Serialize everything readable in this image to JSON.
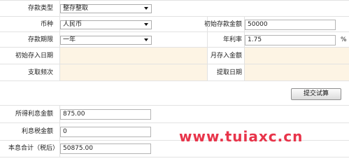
{
  "form": {
    "deposit_type": {
      "label": "存款类型",
      "value": "整存整取"
    },
    "currency": {
      "label": "币种",
      "value": "人民币"
    },
    "initial_amount": {
      "label": "初始存款金额",
      "value": "50000"
    },
    "term": {
      "label": "存款期限",
      "value": "一年"
    },
    "annual_rate": {
      "label": "年利率",
      "value": "1.75",
      "unit": "%"
    },
    "initial_date": {
      "label": "初始存入日期"
    },
    "monthly_amount": {
      "label": "月存入金额"
    },
    "withdraw_frequency": {
      "label": "支取频次"
    },
    "withdraw_date": {
      "label": "提取日期"
    }
  },
  "submit_label": "提交试算",
  "results": {
    "interest": {
      "label": "所得利息金额",
      "value": "875.00"
    },
    "interest_tax": {
      "label": "利息税金额",
      "value": "0"
    },
    "total": {
      "label": "本息合计（税后）",
      "value": "50875.00"
    }
  },
  "watermark": "www.tuiaxc.cn",
  "colors": {
    "highlight_bg": "#fdf4e4",
    "watermark": "#e8344a"
  }
}
